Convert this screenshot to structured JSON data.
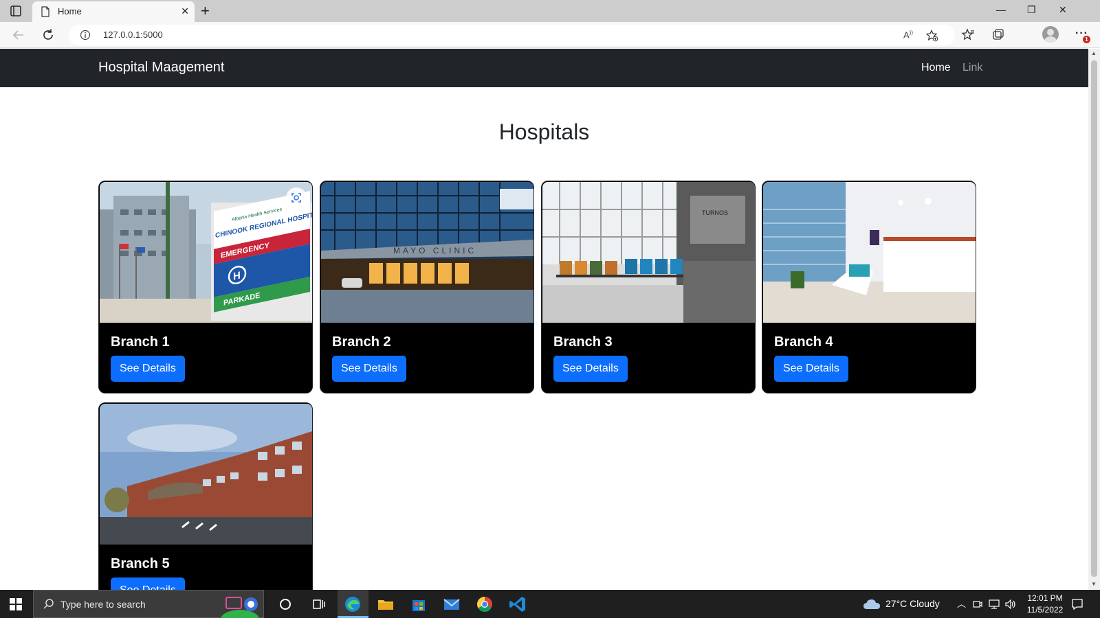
{
  "browser": {
    "tab_title": "Home",
    "url": "127.0.0.1:5000",
    "notification_count": "1"
  },
  "navbar": {
    "brand": "Hospital Maagement",
    "links": [
      "Home",
      "Link"
    ]
  },
  "page": {
    "heading": "Hospitals",
    "cards": [
      {
        "title": "Branch 1",
        "button": "See Details"
      },
      {
        "title": "Branch 2",
        "button": "See Details"
      },
      {
        "title": "Branch 3",
        "button": "See Details"
      },
      {
        "title": "Branch 4",
        "button": "See Details"
      },
      {
        "title": "Branch 5",
        "button": "See Details"
      }
    ],
    "image_signs": {
      "sign_org": "Alberta Health Services",
      "sign_name": "CHINOOK REGIONAL HOSPITAL",
      "sign_emergency": "EMERGENCY",
      "sign_parkade": "PARKADE",
      "sign_clinic": "MAYO CLINIC",
      "sign_turnos": "TURNOS"
    }
  },
  "taskbar": {
    "search_placeholder": "Type here to search",
    "weather": "27°C  Cloudy",
    "time": "12:01 PM",
    "date": "11/5/2022"
  },
  "colors": {
    "navbar_bg": "#212529",
    "card_bg": "#000000",
    "button_primary": "#0d6efd",
    "taskbar_bg": "#1f1f1f"
  }
}
